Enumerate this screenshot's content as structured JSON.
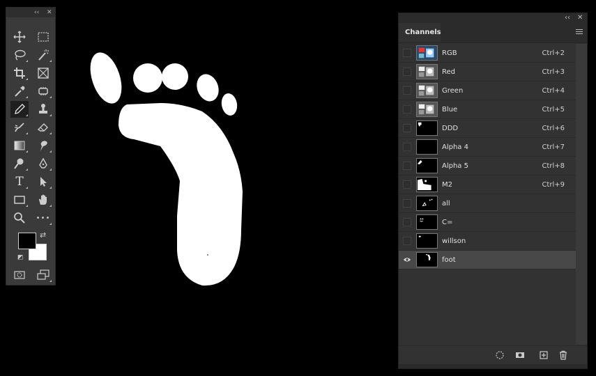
{
  "tools_panel": {
    "collapse_glyph": "‹‹",
    "close_glyph": "✕",
    "tools": [
      {
        "name": "move-icon"
      },
      {
        "name": "marquee-icon"
      },
      {
        "name": "lasso-icon"
      },
      {
        "name": "magic-wand-icon"
      },
      {
        "name": "crop-icon"
      },
      {
        "name": "frame-icon"
      },
      {
        "name": "eyedropper-icon"
      },
      {
        "name": "healing-brush-icon"
      },
      {
        "name": "pencil-icon"
      },
      {
        "name": "clone-stamp-icon"
      },
      {
        "name": "history-brush-icon"
      },
      {
        "name": "eraser-icon"
      },
      {
        "name": "gradient-icon"
      },
      {
        "name": "smudge-icon"
      },
      {
        "name": "dodge-icon"
      },
      {
        "name": "pen-icon"
      },
      {
        "name": "type-icon"
      },
      {
        "name": "path-selection-icon"
      },
      {
        "name": "rectangle-icon"
      },
      {
        "name": "hand-icon"
      },
      {
        "name": "zoom-icon"
      },
      {
        "name": "more-tools-icon"
      }
    ],
    "active_tool": "pencil-icon",
    "type_glyph": "T",
    "more_glyph": "•••",
    "foreground_color": "#000000",
    "background_color": "#ffffff"
  },
  "channels_panel": {
    "collapse_glyph": "‹‹",
    "close_glyph": "✕",
    "tab_label": "Channels",
    "channels": [
      {
        "name": "RGB",
        "shortcut": "Ctrl+2",
        "thumb": "color",
        "visible": false,
        "selected": false
      },
      {
        "name": "Red",
        "shortcut": "Ctrl+3",
        "thumb": "gray",
        "visible": false,
        "selected": false
      },
      {
        "name": "Green",
        "shortcut": "Ctrl+4",
        "thumb": "gray",
        "visible": false,
        "selected": false
      },
      {
        "name": "Blue",
        "shortcut": "Ctrl+5",
        "thumb": "gray",
        "visible": false,
        "selected": false
      },
      {
        "name": "DDD",
        "shortcut": "Ctrl+6",
        "thumb": "mask-small",
        "visible": false,
        "selected": false
      },
      {
        "name": "Alpha 4",
        "shortcut": "Ctrl+7",
        "thumb": "black",
        "visible": false,
        "selected": false
      },
      {
        "name": "Alpha 5",
        "shortcut": "Ctrl+8",
        "thumb": "mask-corner",
        "visible": false,
        "selected": false
      },
      {
        "name": "M2",
        "shortcut": "Ctrl+9",
        "thumb": "mask-large",
        "visible": false,
        "selected": false
      },
      {
        "name": "all",
        "shortcut": "",
        "thumb": "mask-dots",
        "visible": false,
        "selected": false
      },
      {
        "name": "C=",
        "shortcut": "",
        "thumb": "mask-face",
        "visible": false,
        "selected": false
      },
      {
        "name": "willson",
        "shortcut": "",
        "thumb": "mask-tiny",
        "visible": false,
        "selected": false
      },
      {
        "name": "foot",
        "shortcut": "",
        "thumb": "mask-foot",
        "visible": true,
        "selected": true
      }
    ]
  },
  "colors": {
    "panel_bg": "#323232",
    "selected_row": "#484848",
    "canvas_bg": "#000000"
  }
}
